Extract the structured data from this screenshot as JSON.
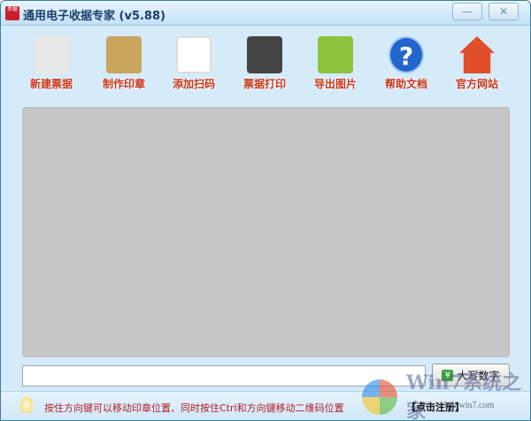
{
  "window": {
    "title": "通用电子收据专家 (v5.88)",
    "app_icon_text": "票据",
    "minimize": "—",
    "close": "✕"
  },
  "toolbar": [
    {
      "label": "新建票据",
      "icon": "receipt-icon",
      "color": "#e8e8e8"
    },
    {
      "label": "制作印章",
      "icon": "seal-icon",
      "color": "#c9a55e"
    },
    {
      "label": "添加扫码",
      "icon": "qrcode-icon",
      "color": "#ffffff"
    },
    {
      "label": "票据打印",
      "icon": "printer-icon",
      "color": "#444444"
    },
    {
      "label": "导出图片",
      "icon": "image-icon",
      "color": "#8cc43e"
    },
    {
      "label": "帮助文档",
      "icon": "help-icon",
      "color": "#2266cc"
    },
    {
      "label": "官方网站",
      "icon": "home-icon",
      "color": "#e0502a"
    }
  ],
  "amount_input": {
    "value": "",
    "placeholder": ""
  },
  "convert_button": {
    "label": "大写数字",
    "icon": "yen-icon"
  },
  "status": {
    "tip": "按住方向键可以移动印章位置、同时按住Ctrl和方向键移动二维码位置",
    "register": "【点击注册】"
  },
  "watermark": {
    "brand": "Win7系统之家",
    "url": "Www.Winwin7.com"
  }
}
